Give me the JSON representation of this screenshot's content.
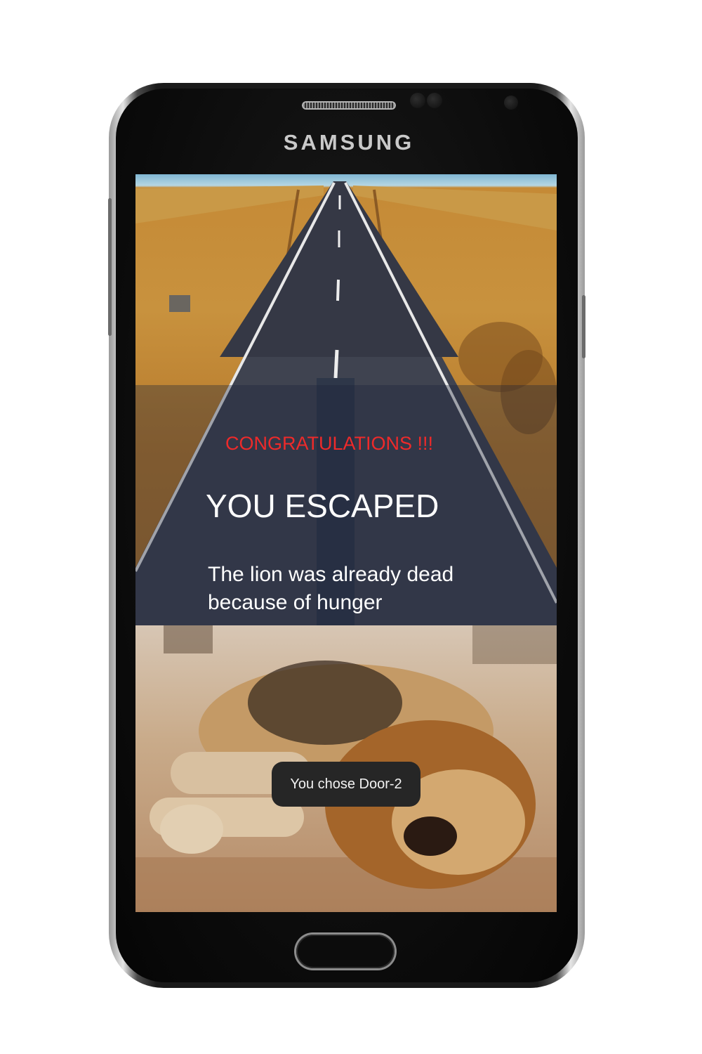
{
  "device": {
    "brand": "SAMSUNG"
  },
  "screen": {
    "congrats_text": "CONGRATULATIONS !!!",
    "headline": "YOU ESCAPED",
    "message": "The lion was already dead because of hunger",
    "toast": "You chose Door-2"
  },
  "images": {
    "top": "desert-road-photo",
    "bottom": "lying-lion-photo"
  },
  "colors": {
    "congrats": "#ee2a2a",
    "headline": "#ffffff",
    "toast_bg": "#262626"
  }
}
